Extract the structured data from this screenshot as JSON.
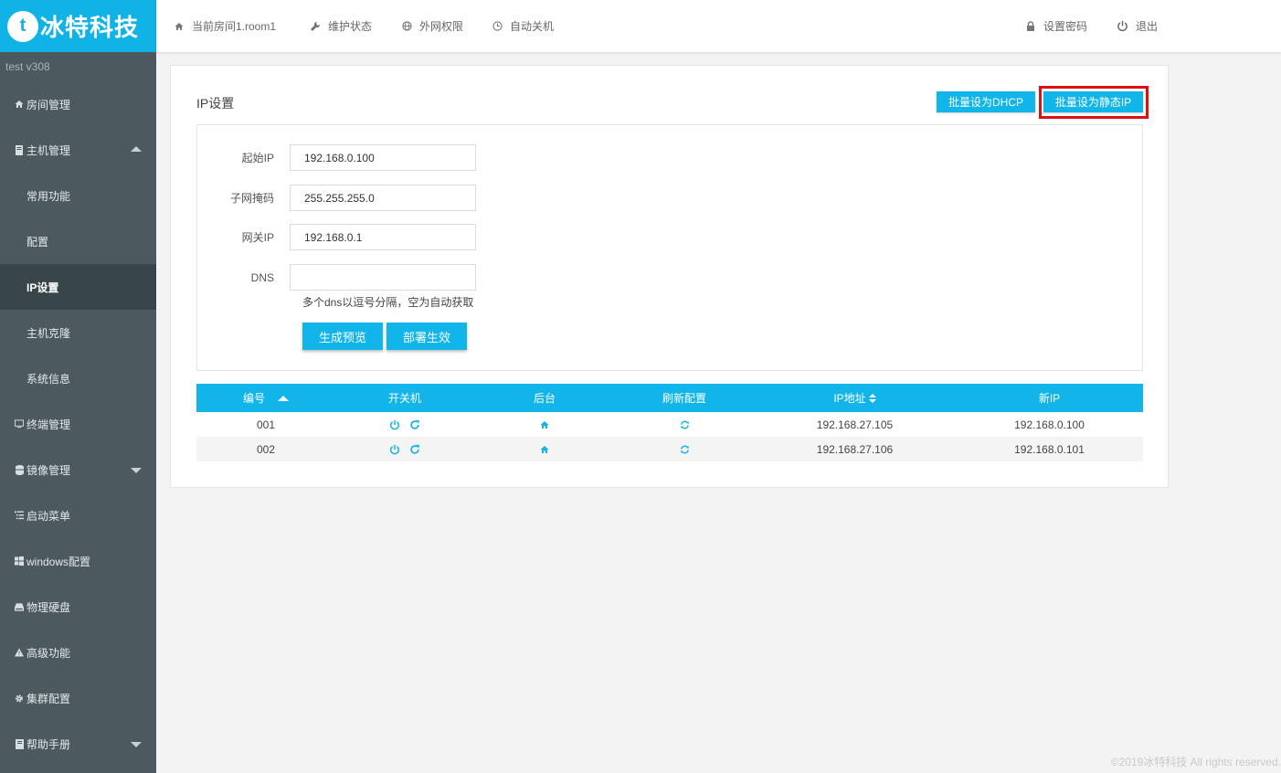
{
  "brand": {
    "logo_letter": "t",
    "name": "冰特科技"
  },
  "topnav": {
    "room": "当前房间1.room1",
    "maintenance": "维护状态",
    "internet": "外网权限",
    "auto_shutdown": "自动关机",
    "set_password": "设置密码",
    "logout": "退出"
  },
  "sidebar": {
    "version": "test  v308",
    "items": [
      {
        "label": "房间管理",
        "icon": "home-icon"
      },
      {
        "label": "主机管理",
        "icon": "server-icon",
        "expanded": true
      },
      {
        "label": "常用功能",
        "sub": true
      },
      {
        "label": "配置",
        "sub": true
      },
      {
        "label": "IP设置",
        "sub": true,
        "active": true
      },
      {
        "label": "主机克隆",
        "sub": true
      },
      {
        "label": "系统信息",
        "sub": true
      },
      {
        "label": "终端管理",
        "icon": "monitor-icon"
      },
      {
        "label": "镜像管理",
        "icon": "database-icon",
        "collapsed": true
      },
      {
        "label": "启动菜单",
        "icon": "list-icon"
      },
      {
        "label": "windows配置",
        "icon": "windows-icon"
      },
      {
        "label": "物理硬盘",
        "icon": "harddisk-icon"
      },
      {
        "label": "高级功能",
        "icon": "warning-icon"
      },
      {
        "label": "集群配置",
        "icon": "gear-icon"
      },
      {
        "label": "帮助手册",
        "icon": "book-icon",
        "collapsed": true
      }
    ]
  },
  "card": {
    "title": "IP设置",
    "btn_dhcp": "批量设为DHCP",
    "btn_static": "批量设为静态IP"
  },
  "form": {
    "start_ip_label": "起始IP",
    "start_ip_value": "192.168.0.100",
    "mask_label": "子网掩码",
    "mask_value": "255.255.255.0",
    "gateway_label": "网关IP",
    "gateway_value": "192.168.0.1",
    "dns_label": "DNS",
    "dns_value": "",
    "dns_hint": "多个dns以逗号分隔，空为自动获取",
    "btn_preview": "生成预览",
    "btn_deploy": "部署生效"
  },
  "table": {
    "headers": [
      "编号",
      "开关机",
      "后台",
      "刷新配置",
      "IP地址",
      "新IP"
    ],
    "rows": [
      {
        "id": "001",
        "ip": "192.168.27.105",
        "new_ip": "192.168.0.100"
      },
      {
        "id": "002",
        "ip": "192.168.27.106",
        "new_ip": "192.168.0.101"
      }
    ]
  },
  "footer": "©2019冰特科技 All rights reserved.",
  "colors": {
    "accent": "#12b5ea",
    "sidebar": "#4c5a60",
    "sidebar_active": "#38454a",
    "highlight": "#dd1111"
  }
}
